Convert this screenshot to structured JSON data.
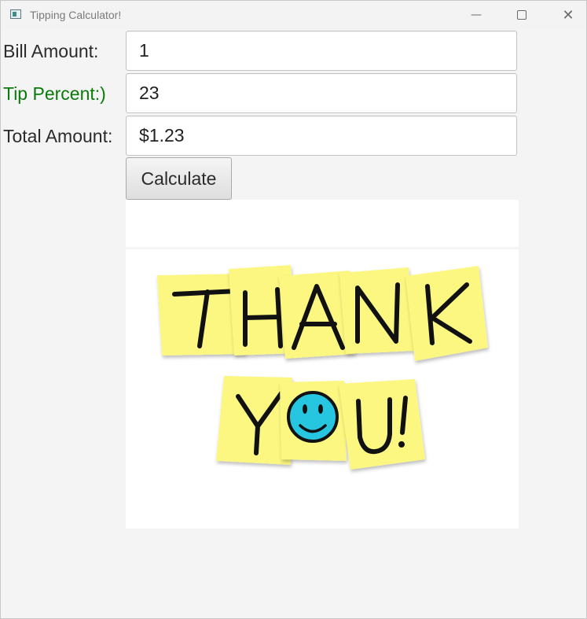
{
  "window": {
    "title": "Tipping Calculator!",
    "controls": {
      "minimize": "—",
      "close": "✕"
    }
  },
  "form": {
    "bill": {
      "label": "Bill Amount:",
      "value": "1"
    },
    "tip": {
      "label": "Tip Percent:)",
      "value": "23",
      "label_color": "#0a7a0a"
    },
    "total": {
      "label": "Total Amount:",
      "value": "$1.23"
    },
    "calculate_label": "Calculate"
  },
  "image": {
    "line1_letters": [
      "T",
      "H",
      "A",
      "N",
      "K"
    ],
    "line2_letters": [
      "Y",
      "U",
      "!"
    ],
    "note_color": "#fbf781",
    "smiley_color": "#26c6e0"
  }
}
